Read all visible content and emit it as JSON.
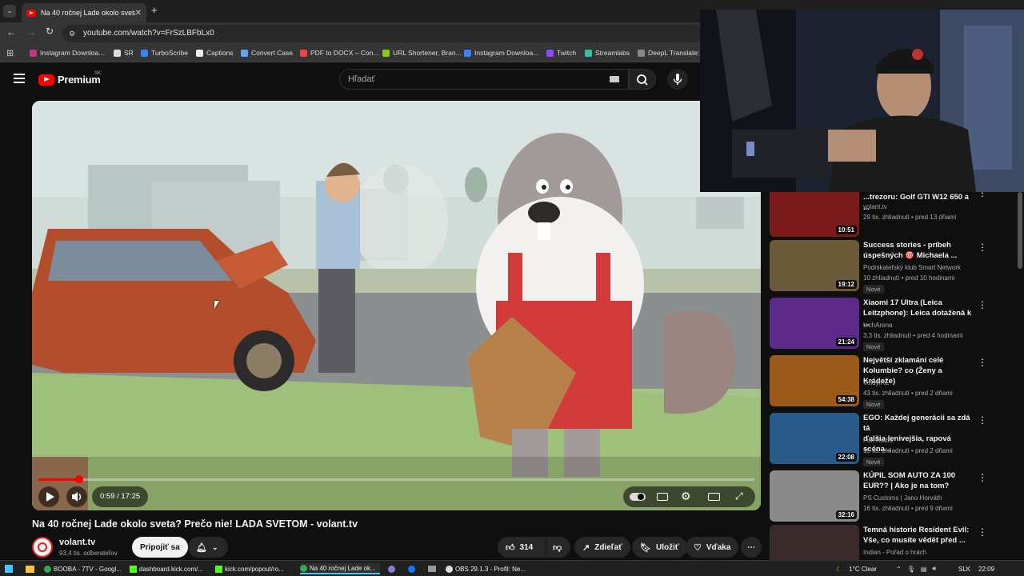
{
  "browser": {
    "tab_title": "Na 40 ročnej Lade okolo sveta?",
    "url": "youtube.com/watch?v=FrSzLBFbLx0",
    "bookmarks": [
      {
        "label": "Instagram Downloa...",
        "color": "#c13584"
      },
      {
        "label": "SR",
        "color": "#dddddd"
      },
      {
        "label": "TurboScribe",
        "color": "#3b82f6"
      },
      {
        "label": "Captions",
        "color": "#eeeeee"
      },
      {
        "label": "Convert Case",
        "color": "#60a5fa"
      },
      {
        "label": "PDF to DOCX – Con...",
        "color": "#ef4444"
      },
      {
        "label": "URL Shortener, Bran...",
        "color": "#84cc16"
      },
      {
        "label": "Instagram Downloa...",
        "color": "#3b82f6"
      },
      {
        "label": "Twitch",
        "color": "#9146ff"
      },
      {
        "label": "Streamlabs",
        "color": "#31c3a2"
      },
      {
        "label": "DeepL Translate: N",
        "color": "#888888"
      }
    ]
  },
  "youtube": {
    "logo_text": "Premium",
    "region": "SK",
    "search_placeholder": "Hľadať"
  },
  "player": {
    "time": "0:59 / 17:25",
    "progress": 0.0565
  },
  "video": {
    "title": "Na 40 ročnej Lade okolo sveta? Prečo nie! LADA SVETOM - volant.tv",
    "channel": "volant.tv",
    "subscribers": "93,4 tis. odberateľov",
    "join_label": "Pripojiť sa",
    "likes": "314",
    "share_label": "Zdieľať",
    "save_label": "Uložiť",
    "thanks_label": "Vďaka"
  },
  "recommendations": [
    {
      "title_1": "...trezoru: Golf GTI W12 650 a ...",
      "title_2": "",
      "channel": "volant.tv",
      "meta": "29 tis. zhliadnutí • pred 13 dňami",
      "duration": "10:51",
      "badge": "",
      "thumb": "#7a1a1a"
    },
    {
      "title_1": "Success stories - príbeh",
      "title_2": "úspešných 🎯 Michaela ...",
      "channel": "Podnikateľský klub Smart Network",
      "meta": "10 zhliadnutí • pred 10 hodinami",
      "duration": "19:12",
      "badge": "Nové",
      "thumb": "#6b5a3a"
    },
    {
      "title_1": "Xiaomi 17 Ultra (Leica",
      "title_2": "Leitzphone): Leica dotažená k ...",
      "channel": "techArena",
      "meta": "3,3 tis. zhliadnutí • pred 4 hodinami",
      "duration": "21:24",
      "badge": "Nové",
      "thumb": "#5b2a8a"
    },
    {
      "title_1": "Největší zklamání celé",
      "title_2": "Kolumbie? co (Ženy a Krádeže)",
      "channel": "VoldyIRL",
      "meta": "43 tis. zhliadnutí • pred 2 dňami",
      "duration": "54:38",
      "badge": "Nové",
      "thumb": "#9a5a1a"
    },
    {
      "title_1": "EGO: Každej generácii sa zdá tá",
      "title_2": "ďalšia lenivejšia, rapová scéna...",
      "channel": "Fun Radio",
      "meta": "15 tis. zhliadnutí • pred 2 dňami",
      "duration": "22:08",
      "badge": "Nové",
      "thumb": "#2a5a8a"
    },
    {
      "title_1": "KÚPIL SOM AUTO ZA 100",
      "title_2": "EUR?? | Ako je na tom?",
      "channel": "PS Customs | Jano Horváth",
      "meta": "16 tis. zhliadnutí • pred 9 dňami",
      "duration": "32:16",
      "badge": "",
      "thumb": "#8a8a8a"
    },
    {
      "title_1": "Temná historie Resident Evil:",
      "title_2": "Vše, co musíte vědět před ...",
      "channel": "Indian - Pořad o hrách",
      "meta": "",
      "duration": "",
      "badge": "",
      "thumb": "#3a2a2a"
    }
  ],
  "taskbar": {
    "items": [
      "BOOBA - 7TV - Googl...",
      "dashboard.kick.com/...",
      "kick.com/popout/ro...",
      "Na 40 ročnej Lade ok...",
      "OBS 29.1.3 - Profil: Ne..."
    ],
    "weather": "1°C  Clear",
    "lang": "SLK",
    "time": "22:09"
  }
}
